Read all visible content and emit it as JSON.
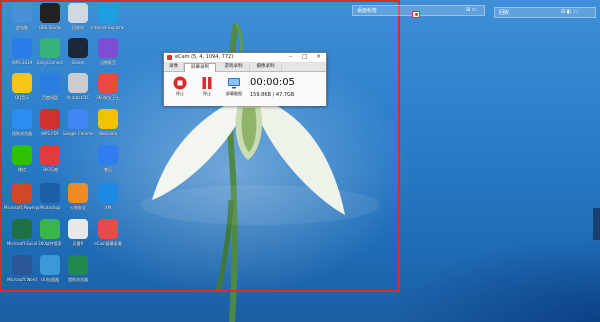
{
  "desktop_icons": [
    {
      "label": "此电脑",
      "color": "#4a90d9",
      "name": "this-pc-icon"
    },
    {
      "label": "OBS Studio",
      "color": "#222222",
      "name": "obs-icon"
    },
    {
      "label": "回收站",
      "color": "#cfd8e3",
      "name": "recycle-bin-icon"
    },
    {
      "label": "Internet Explorer",
      "color": "#1ea0e0",
      "name": "ie-icon"
    },
    {
      "label": "WPS 2019",
      "color": "#2b7de9",
      "name": "wps-icon"
    },
    {
      "label": "EasyConnect",
      "color": "#35b27a",
      "name": "easyconnect-icon"
    },
    {
      "label": "Steam",
      "color": "#1b2838",
      "name": "steam-icon"
    },
    {
      "label": "迅雷影音",
      "color": "#7b4ed3",
      "name": "xunlei-player-icon"
    },
    {
      "label": "QQ音乐",
      "color": "#f5c518",
      "name": "qq-music-icon"
    },
    {
      "label": "百度网盘",
      "color": "#2a7de1",
      "name": "baidu-netdisk-icon"
    },
    {
      "label": "Acrobat DC",
      "color": "#cccccc",
      "name": "acrobat-icon"
    },
    {
      "label": "360安全卫士",
      "color": "#e94b3c",
      "name": "360-security-icon"
    },
    {
      "label": "搜狗浏览器",
      "color": "#2d8cf0",
      "name": "sogou-browser-icon"
    },
    {
      "label": "WPS PDF",
      "color": "#d0302e",
      "name": "wps-pdf-icon"
    },
    {
      "label": "Google Chrome",
      "color": "#4285f4",
      "name": "chrome-icon"
    },
    {
      "label": "WeGame",
      "color": "#f2c200",
      "name": "wegame-icon"
    },
    {
      "label": "微信",
      "color": "#2dc100",
      "name": "wechat-icon"
    },
    {
      "label": "360压缩",
      "color": "#e23b3b",
      "name": "360-zip-icon"
    },
    {
      "label": "笔记",
      "color": "#2f7df0",
      "name": "note-icon"
    },
    {
      "label": "Microsoft Powerpoint",
      "color": "#d24726",
      "name": "powerpoint-icon"
    },
    {
      "label": "Photoshop",
      "color": "#1b5fa8",
      "name": "photoshop-icon"
    },
    {
      "label": "火绒安全",
      "color": "#f08a24",
      "name": "huorong-icon"
    },
    {
      "label": "XM",
      "color": "#1e88e5",
      "name": "xm-icon"
    },
    {
      "label": "Microsoft Excel",
      "color": "#1e7145",
      "name": "excel-icon"
    },
    {
      "label": "360软件管家",
      "color": "#39b54a",
      "name": "360-software-icon"
    },
    {
      "label": "迅雷X",
      "color": "#e8e8e8",
      "name": "thunder-icon"
    },
    {
      "label": "eCam屏幕录像",
      "color": "#e84a4a",
      "name": "ecam-desktop-icon"
    },
    {
      "label": "Microsoft Word",
      "color": "#2b579a",
      "name": "word-icon"
    },
    {
      "label": "UU加速器",
      "color": "#3a9ad9",
      "name": "uu-booster-icon"
    },
    {
      "label": "猎豹浏览器",
      "color": "#1f8a4c",
      "name": "liebao-icon"
    }
  ],
  "widget_left": {
    "title": "桌面标签",
    "ctl": "⊞ ▭"
  },
  "widget_right": {
    "title": "回收",
    "ctl": "⊟ ◧ ▭"
  },
  "ecam": {
    "title": "eCam (5, 4, 1094, 772)",
    "controls": {
      "min": "–",
      "max": "□",
      "close": "×"
    },
    "tabs": [
      "录像",
      "屏幕录制",
      "游戏录制",
      "摄像录制"
    ],
    "active_tab": 1,
    "buttons": {
      "stop": "停止",
      "pause": "停止",
      "screen": "屏幕截图"
    },
    "timer": "00:00:05",
    "size": "159.8KB / 47.7GB"
  },
  "colors": {
    "frame": "#d03030",
    "record_red": "#d92b2b",
    "screen_blue": "#2a6fc9"
  }
}
